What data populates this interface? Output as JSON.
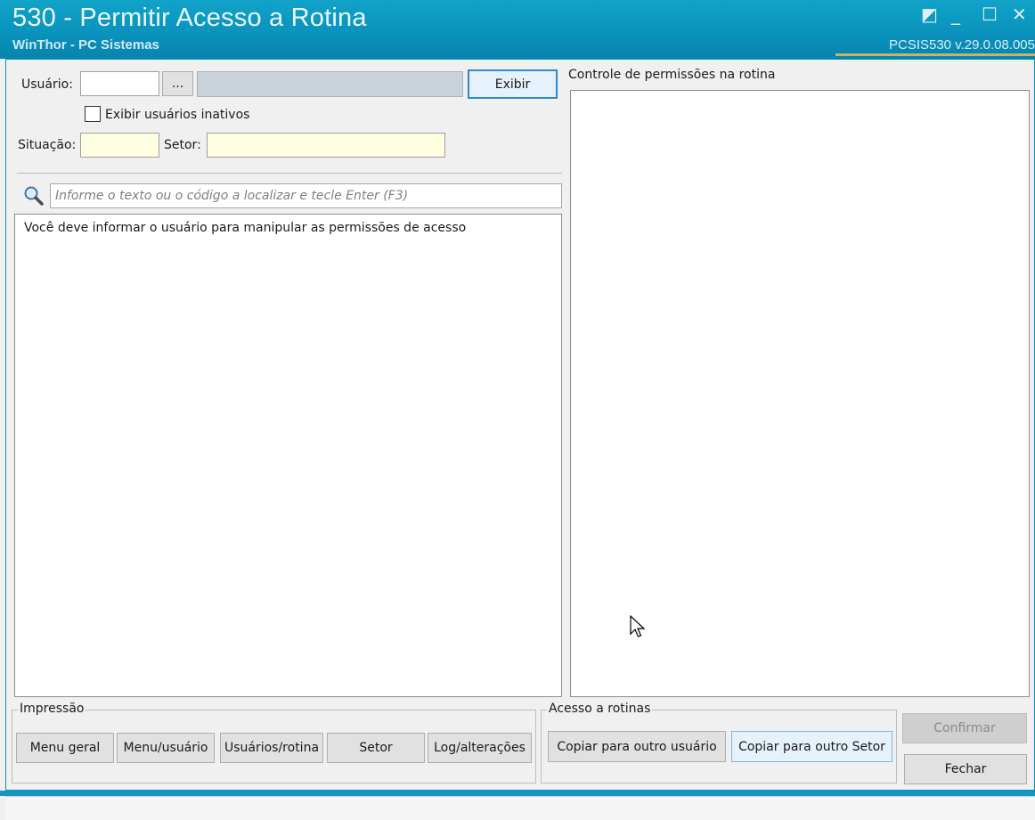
{
  "window": {
    "title": "530 - Permitir Acesso a Rotina",
    "subtitle": "WinThor - PC Sistemas",
    "version": "PCSIS530  v.29.0.08.005",
    "controls": {
      "restore": "◩",
      "minimize": "_",
      "maximize": "☐",
      "close": "✕"
    }
  },
  "filters": {
    "usuario_label": "Usuário:",
    "usuario_value": "",
    "lookup_button": "...",
    "exibir_button": "Exibir",
    "inativos_label": "Exibir usuários inativos",
    "inativos_checked": false,
    "situacao_label": "Situação:",
    "situacao_value": "",
    "setor_label": "Setor:",
    "setor_value": ""
  },
  "search": {
    "placeholder": "Informe o texto ou o código a localizar e tecle Enter (F3)"
  },
  "tree": {
    "message": "Você deve informar o usuário para manipular as permissões de acesso"
  },
  "permissions": {
    "title": "Controle de permissões na rotina"
  },
  "impressao": {
    "title": "Impressão",
    "buttons": [
      "Menu geral",
      "Menu/usuário",
      "Usuários/rotina",
      "Setor",
      "Log/alterações"
    ]
  },
  "acesso": {
    "title": "Acesso a rotinas",
    "copy_user": "Copiar para outro usuário",
    "copy_setor": "Copiar para outro Setor"
  },
  "actions": {
    "confirmar": "Confirmar",
    "fechar": "Fechar"
  },
  "colors": {
    "title_bar": "#0a93bd",
    "accent": "#c9b36b",
    "focus": "#2c88d0",
    "required_field": "#ffffe1"
  }
}
